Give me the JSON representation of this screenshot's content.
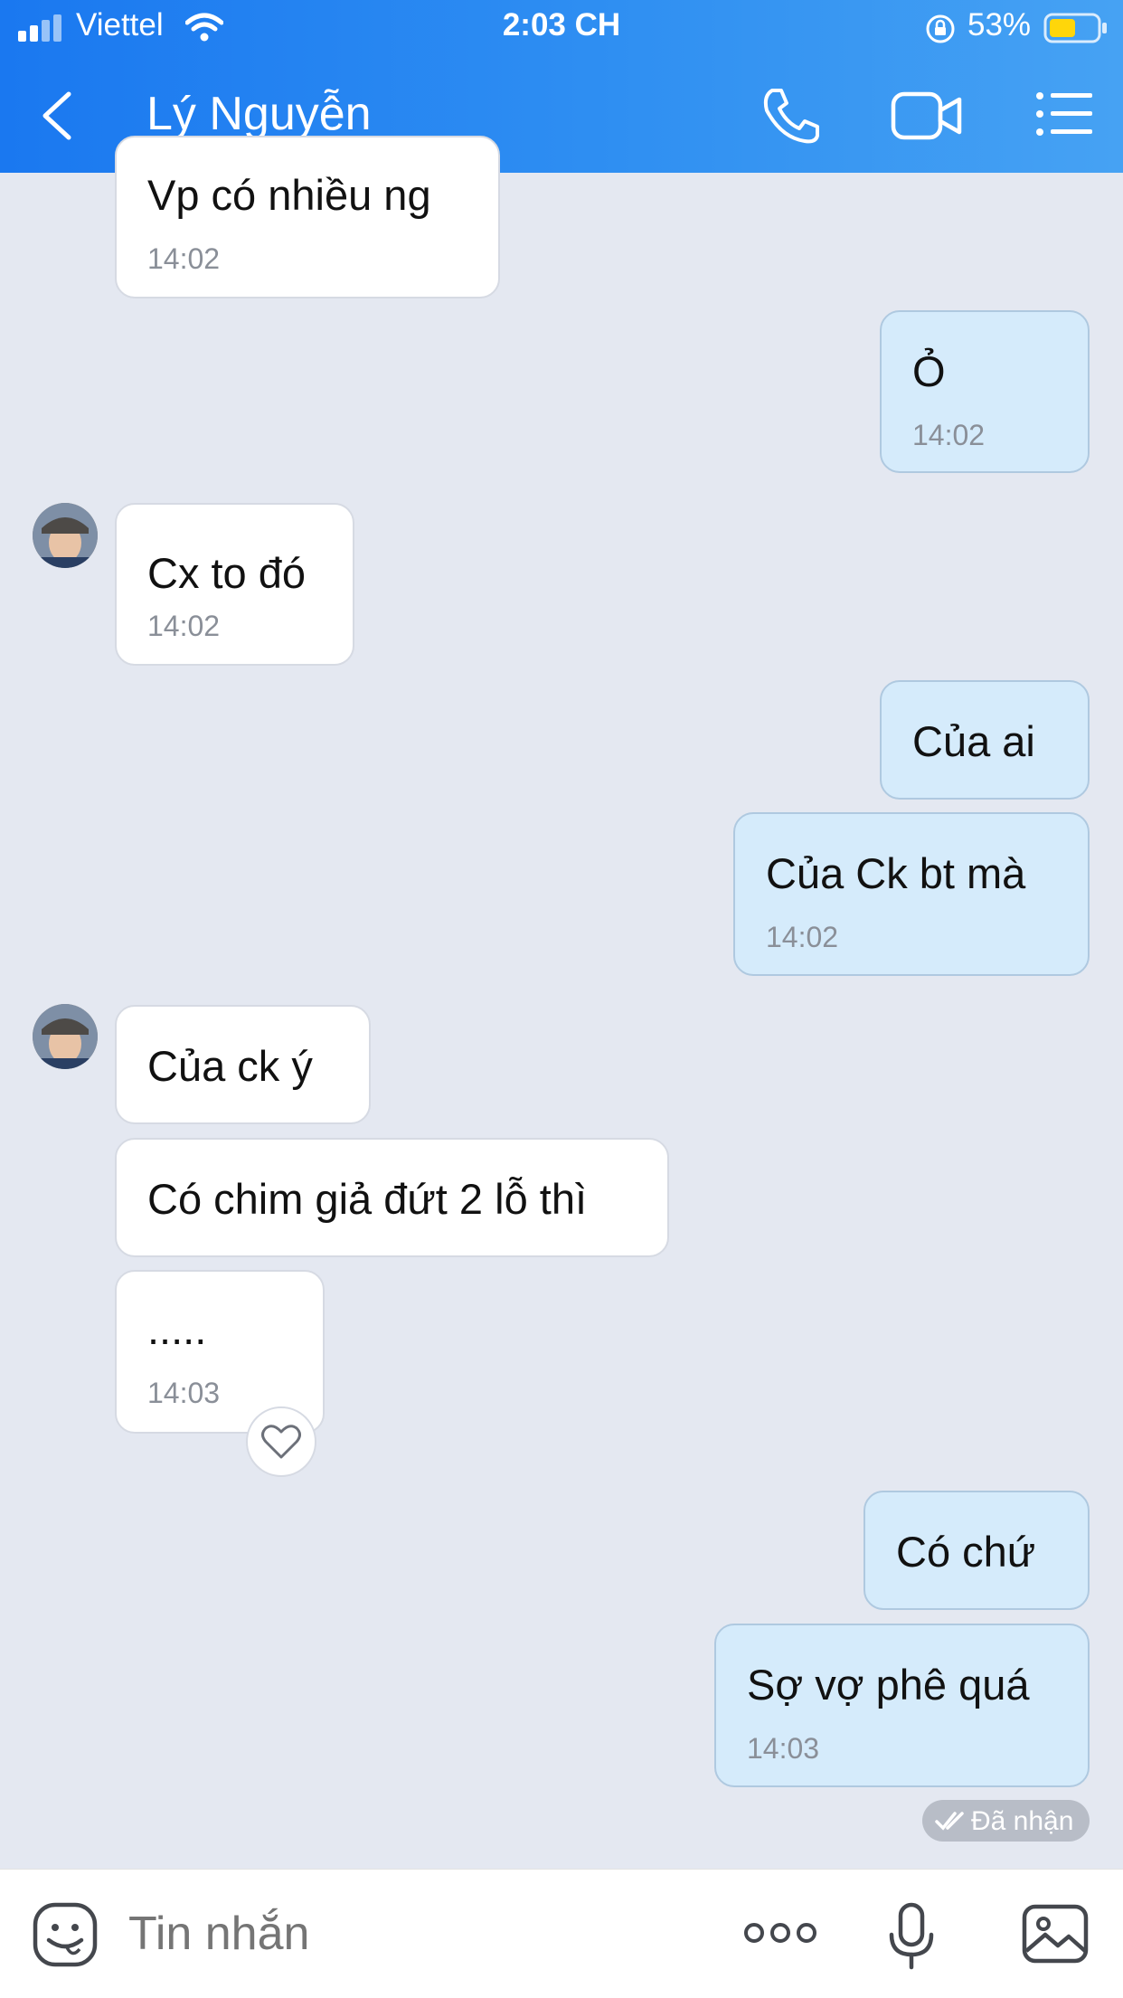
{
  "status_bar": {
    "carrier": "Viettel",
    "time": "2:03 CH",
    "battery": "53%"
  },
  "header": {
    "title": "Lý Nguyễn"
  },
  "messages": [
    {
      "text": "Vp có nhiều ng",
      "time": "14:02"
    },
    {
      "text": "Ỏ",
      "time": "14:02"
    },
    {
      "text": "Cx to đó",
      "time": "14:02"
    },
    {
      "text": "Của ai"
    },
    {
      "text": "Của Ck bt mà",
      "time": "14:02"
    },
    {
      "text": "Của ck ý"
    },
    {
      "text": "Có chim giả đứt 2 lỗ thì"
    },
    {
      "text": ".....",
      "time": "14:03"
    },
    {
      "text": "Có chứ"
    },
    {
      "text": "Sợ vợ phê quá",
      "time": "14:03"
    }
  ],
  "received_label": "Đã nhận",
  "input": {
    "placeholder": "Tin nhắn"
  },
  "colors": {
    "header_start": "#1a78f0",
    "header_end": "#46a2f3",
    "outgoing_bubble": "#d5ebfb",
    "chat_background": "#e4e8f1"
  },
  "icons": [
    "back-icon",
    "phone-icon",
    "video-camera-icon",
    "menu-list-icon",
    "heart-icon",
    "double-check-icon",
    "emoji-icon",
    "more-dots-icon",
    "microphone-icon",
    "image-icon"
  ]
}
